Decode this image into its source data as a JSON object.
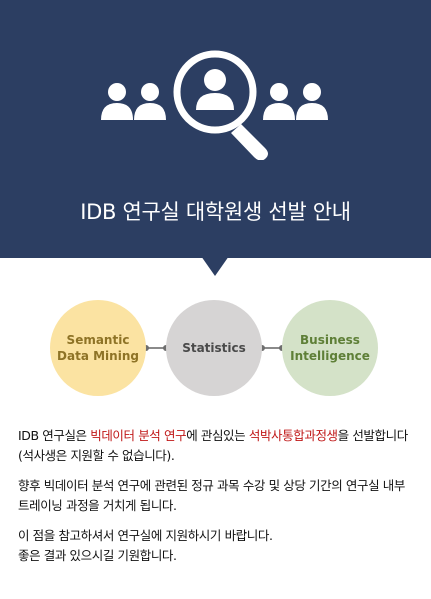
{
  "banner": {
    "title": "IDB 연구실 대학원생 선발 안내",
    "icon": "people-search-icon"
  },
  "colors": {
    "banner_bg": "#2c3e62",
    "highlight": "#c01818",
    "circle_semantic": "#fbe3a2",
    "circle_statistics": "#d6d4d4",
    "circle_business": "#d4e2c8"
  },
  "circles": {
    "semantic": {
      "line1": "Semantic",
      "line2": "Data Mining"
    },
    "statistics": {
      "line1": "Statistics"
    },
    "business": {
      "line1": "Business",
      "line2": "Intelligence"
    }
  },
  "body": {
    "p1": {
      "a": "IDB 연구실은 ",
      "b": "빅데이터 분석 연구",
      "c": "에 관심있는 ",
      "d": "석박사통합과정생",
      "e": "을 선발합니다(석사생은 지원할 수 없습니다)."
    },
    "p2": "향후 빅데이터 분석 연구에 관련된 정규 과목 수강 및 상당 기간의 연구실 내부 트레이닝 과정을 거치게 됩니다.",
    "p3": {
      "line1": "이 점을 참고하셔서 연구실에 지원하시기 바랍니다.",
      "line2": "좋은 결과 있으시길 기원합니다."
    }
  }
}
